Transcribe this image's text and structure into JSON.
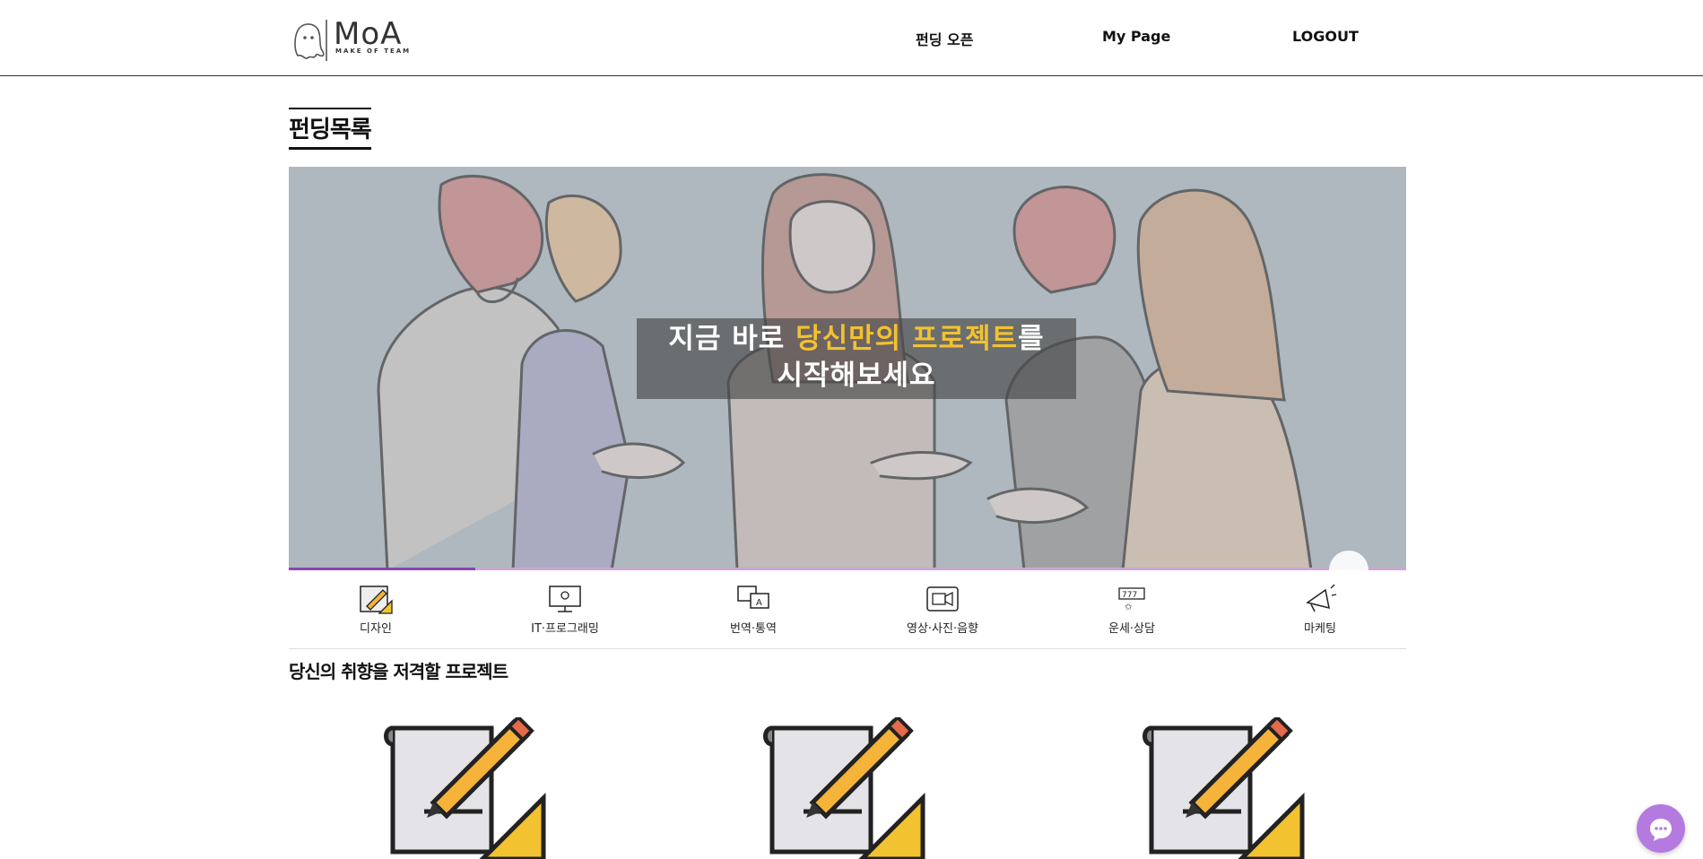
{
  "header": {
    "logo_text": "MoA",
    "logo_subtext": "MAKE OF TEAM",
    "nav": {
      "funding_open": "펀딩 오픈",
      "my_page": "My Page",
      "logout": "LOGOUT"
    }
  },
  "page": {
    "title": "펀딩목록"
  },
  "banner": {
    "line1_prefix": "지금 바로 ",
    "line1_highlight": "당신만의 프로젝트",
    "line1_suffix": "를",
    "line2": "시작해보세요",
    "highlight_color": "#f2c230",
    "progress_fraction": 0.167
  },
  "categories": [
    {
      "label": "디자인",
      "icon": "design-icon"
    },
    {
      "label": "IT·프로그래밍",
      "icon": "computer-icon"
    },
    {
      "label": "번역·통역",
      "icon": "translation-icon"
    },
    {
      "label": "영상·사진·음향",
      "icon": "video-camera-icon"
    },
    {
      "label": "운세·상담",
      "icon": "fortune-icon"
    },
    {
      "label": "마케팅",
      "icon": "megaphone-icon"
    }
  ],
  "section": {
    "title": "당신의 취향을 저격할 프로젝트"
  },
  "projects": [
    {
      "icon": "design-icon"
    },
    {
      "icon": "design-icon"
    },
    {
      "icon": "design-icon"
    }
  ],
  "colors": {
    "accent": "#8b44b3",
    "chat_button": "#b57ae0"
  }
}
